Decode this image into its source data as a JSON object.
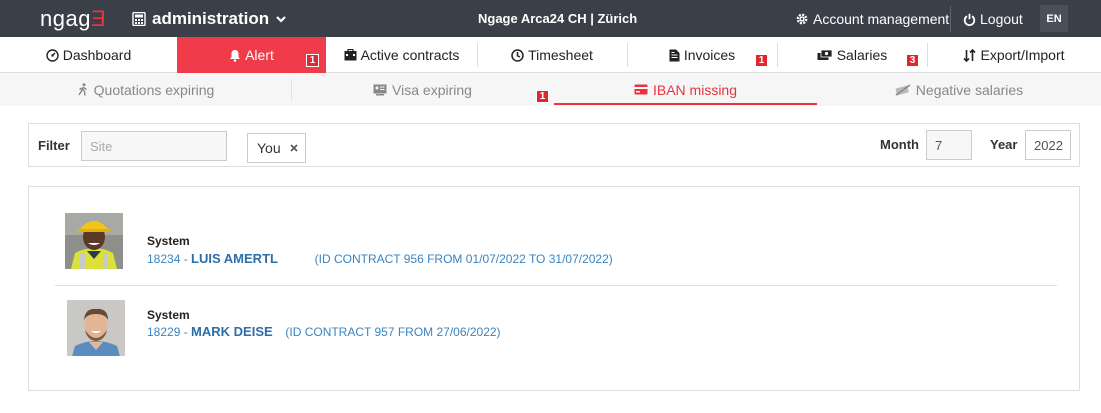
{
  "app": {
    "logo_main": "ngag",
    "logo_accent": "Ǝ",
    "module": "administration",
    "company": "Ngage Arca24 CH | Zürich",
    "account_label": "Account management",
    "logout_label": "Logout",
    "lang": "EN"
  },
  "main_tabs": [
    {
      "label": "Dashboard",
      "icon": "dashboard-icon",
      "badge": null
    },
    {
      "label": "Alert",
      "icon": "bell-icon",
      "badge": "1",
      "active": true
    },
    {
      "label": "Active contracts",
      "icon": "contracts-icon",
      "badge": null
    },
    {
      "label": "Timesheet",
      "icon": "clock-icon",
      "badge": null
    },
    {
      "label": "Invoices",
      "icon": "invoice-icon",
      "badge": "1"
    },
    {
      "label": "Salaries",
      "icon": "money-icon",
      "badge": "3"
    },
    {
      "label": "Export/Import",
      "icon": "sort-icon",
      "badge": null
    }
  ],
  "sub_tabs": [
    {
      "label": "Quotations expiring",
      "icon": "walking-icon",
      "badge": null
    },
    {
      "label": "Visa expiring",
      "icon": "id-card-icon",
      "badge": "1"
    },
    {
      "label": "IBAN missing",
      "icon": "credit-card-icon",
      "badge": null,
      "active": true
    },
    {
      "label": "Negative salaries",
      "icon": "money-off-icon",
      "badge": null
    }
  ],
  "filter": {
    "label": "Filter",
    "site_placeholder": "Site",
    "chip_label": "You",
    "month_label": "Month",
    "month_value": "7",
    "year_label": "Year",
    "year_value": "2022"
  },
  "items": [
    {
      "source": "System",
      "id": "18234 -",
      "name": "LUIS AMERTL",
      "detail": "(ID CONTRACT 956 FROM 01/07/2022 TO 31/07/2022)"
    },
    {
      "source": "System",
      "id": "18229 -",
      "name": "MARK DEISE",
      "detail": "(ID CONTRACT 957 FROM 27/06/2022)"
    }
  ],
  "colors": {
    "topbar": "#3a3f48",
    "accent": "#ef3b4a",
    "link": "#3a84c0"
  }
}
